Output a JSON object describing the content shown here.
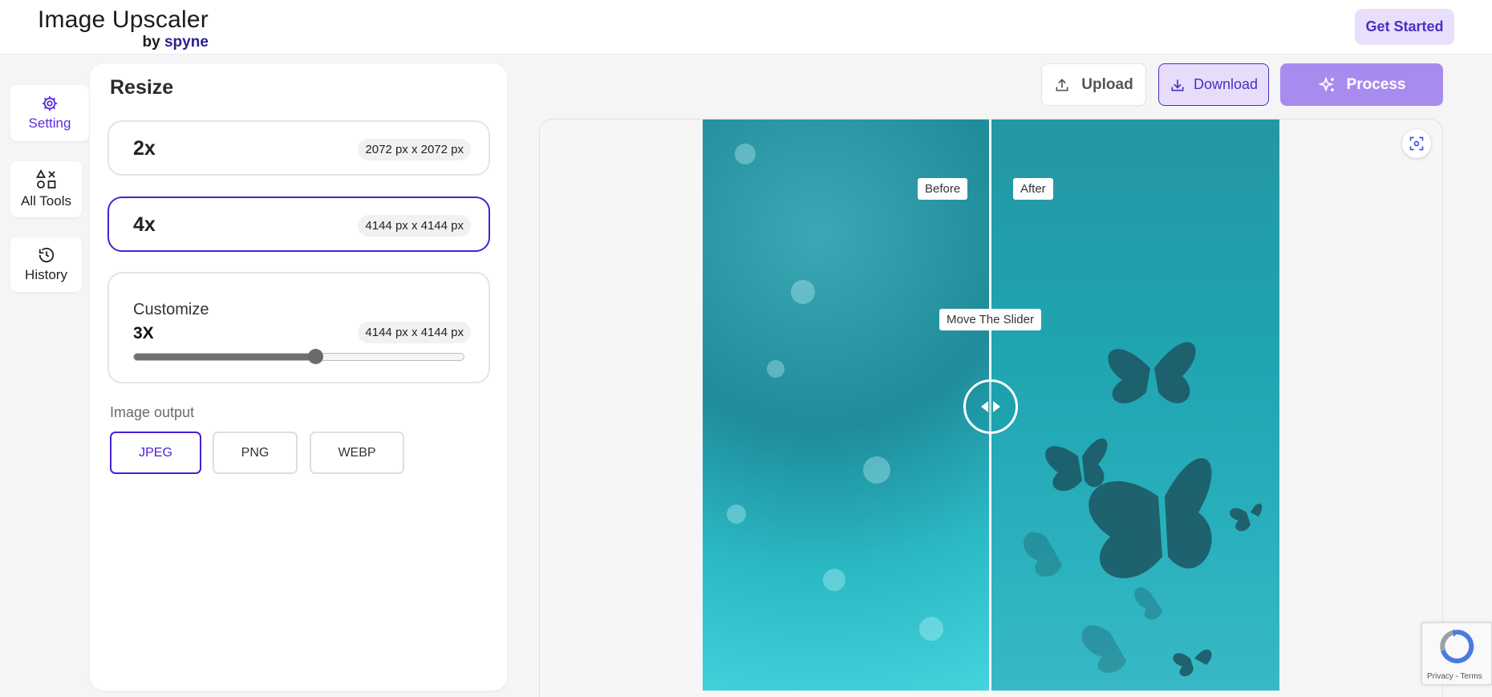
{
  "header": {
    "brand_title": "Image Upscaler",
    "brand_by": "by ",
    "brand_spyne": "spyne",
    "get_started_label": "Get Started"
  },
  "rail": {
    "items": [
      {
        "label": "Setting",
        "icon": "gear-icon",
        "active": true
      },
      {
        "label": "All Tools",
        "icon": "shapes-icon",
        "active": false
      },
      {
        "label": "History",
        "icon": "history-icon",
        "active": false
      }
    ]
  },
  "panel": {
    "title": "Resize",
    "options": [
      {
        "label": "2x",
        "dimensions": "2072 px x 2072 px",
        "selected": false
      },
      {
        "label": "4x",
        "dimensions": "4144 px x 4144 px",
        "selected": true
      }
    ],
    "customize": {
      "label": "Customize",
      "scale": "3X",
      "dimensions": "4144 px x 4144 px",
      "slider_fraction": 0.55
    },
    "output_label": "Image output",
    "formats": [
      {
        "label": "JPEG",
        "selected": true
      },
      {
        "label": "PNG",
        "selected": false
      },
      {
        "label": "WEBP",
        "selected": false
      }
    ]
  },
  "toolbar": {
    "upload_label": "Upload",
    "download_label": "Download",
    "process_label": "Process"
  },
  "preview": {
    "before_label": "Before",
    "after_label": "After",
    "slider_hint": "Move The Slider"
  },
  "recaptcha": {
    "text": "Privacy - Terms"
  },
  "colors": {
    "accent": "#4a1fd6",
    "process_bg": "#a98bf0",
    "get_started_bg": "#e9dffc"
  }
}
